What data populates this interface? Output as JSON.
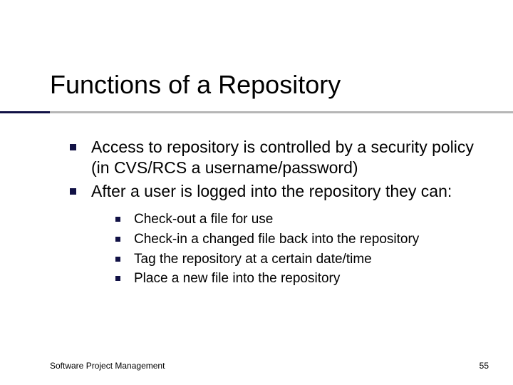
{
  "title": "Functions of a Repository",
  "bullets": {
    "b1": "Access to repository is controlled by a security policy (in CVS/RCS a username/password)",
    "b2": "After a user is logged into the repository they can:"
  },
  "sub": {
    "s1": "Check-out a file for use",
    "s2": "Check-in a changed file back into the repository",
    "s3": "Tag the repository at a certain date/time",
    "s4": "Place a new file into the repository"
  },
  "footer": {
    "left": "Software Project Management",
    "page": "55"
  }
}
